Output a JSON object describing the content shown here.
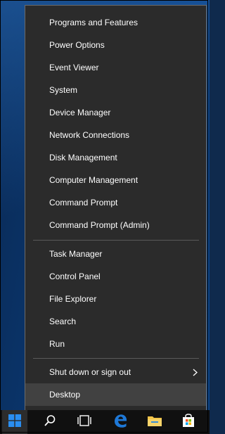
{
  "menu": {
    "group1": [
      "Programs and Features",
      "Power Options",
      "Event Viewer",
      "System",
      "Device Manager",
      "Network Connections",
      "Disk Management",
      "Computer Management",
      "Command Prompt",
      "Command Prompt (Admin)"
    ],
    "group2": [
      "Task Manager",
      "Control Panel",
      "File Explorer",
      "Search",
      "Run"
    ],
    "shutdown": "Shut down or sign out",
    "desktop": "Desktop"
  },
  "taskbar": {
    "icons": [
      "windows-start-icon",
      "search-icon",
      "task-view-icon",
      "edge-icon",
      "file-explorer-icon",
      "store-icon"
    ],
    "colors": {
      "start": "#2a8ef0",
      "edge": "#1e78d7",
      "folder": "#f4c54a",
      "store": "#ffffff"
    }
  }
}
